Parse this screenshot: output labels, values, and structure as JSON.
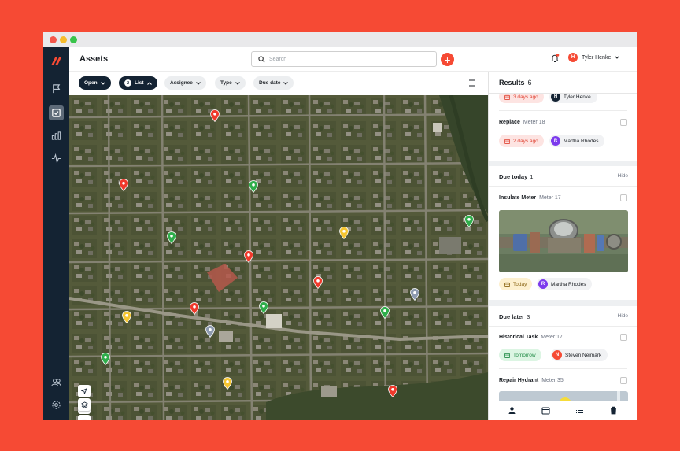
{
  "app": {
    "page_title": "Assets"
  },
  "header": {
    "search_placeholder": "Search",
    "user": {
      "initial": "H",
      "name": "Tyler Henke"
    }
  },
  "filters": {
    "open_label": "Open",
    "list_count": "2",
    "list_label": "List",
    "assignee_label": "Assignee",
    "type_label": "Type",
    "due_label": "Due date"
  },
  "results": {
    "title": "Results",
    "count": "6",
    "first_card": {
      "date": "3 days ago",
      "assignee_initial": "H",
      "assignee": "Tyler Henke"
    },
    "second_card": {
      "title": "Replace",
      "subtitle": "Meter 18",
      "date": "2 days ago",
      "assignee_initial": "R",
      "assignee": "Martha Rhodes"
    },
    "due_today": {
      "title": "Due today",
      "count": "1",
      "hide": "Hide",
      "task": {
        "title": "Insulate Meter",
        "subtitle": "Meter 17",
        "date": "Today",
        "assignee_initial": "R",
        "assignee": "Martha Rhodes"
      }
    },
    "due_later": {
      "title": "Due later",
      "count": "3",
      "hide": "Hide",
      "tasks": [
        {
          "title": "Historical Task",
          "subtitle": "Meter 17",
          "date": "Tomorrow",
          "assignee_initial": "N",
          "assignee": "Steven Neimark"
        },
        {
          "title": "Repair Hydrant",
          "subtitle": "Meter 35"
        }
      ]
    }
  },
  "colors": {
    "brand": "#f64a34",
    "sidebar": "#142333",
    "pin_red": "#f0392b",
    "pin_green": "#2fae4b",
    "pin_yellow": "#f5c531",
    "pin_gray": "#8e9bb0",
    "avatar_red": "#f64a34",
    "avatar_purple": "#7c3aed",
    "avatar_dark": "#142333"
  },
  "map_pins": [
    {
      "color": "red"
    },
    {
      "color": "red"
    },
    {
      "color": "green"
    },
    {
      "color": "green"
    },
    {
      "color": "green"
    },
    {
      "color": "yellow"
    },
    {
      "color": "red"
    },
    {
      "color": "red"
    },
    {
      "color": "red"
    },
    {
      "color": "green"
    },
    {
      "color": "yellow"
    },
    {
      "color": "gray"
    },
    {
      "color": "green"
    },
    {
      "color": "gray"
    },
    {
      "color": "green"
    },
    {
      "color": "yellow"
    },
    {
      "color": "red"
    }
  ]
}
